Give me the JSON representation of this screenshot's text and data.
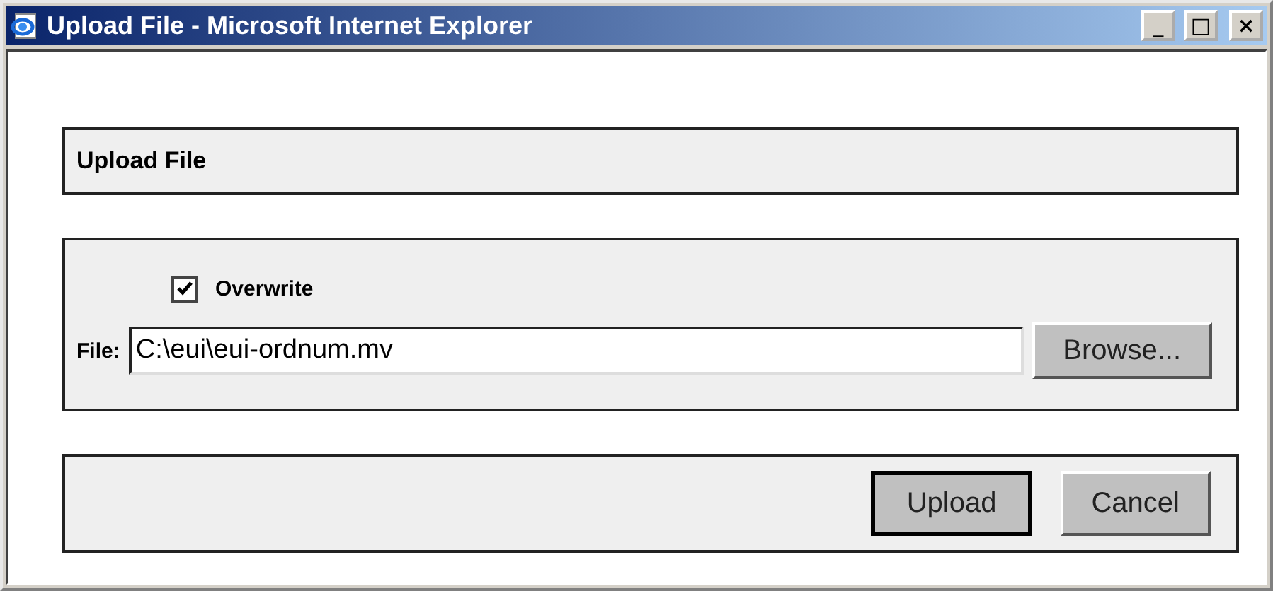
{
  "window": {
    "title": "Upload File - Microsoft Internet Explorer",
    "controls": [
      "_",
      "□",
      "×"
    ]
  },
  "header": {
    "title": "Upload File"
  },
  "options": {
    "overwrite": {
      "label": "Overwrite",
      "checked": true
    },
    "file": {
      "label": "File:",
      "value": "C:\\eui\\eui-ordnum.mv"
    },
    "browse_button": "Browse..."
  },
  "buttons": [
    {
      "label": "Upload",
      "default": true
    },
    {
      "label": "Cancel",
      "default": false
    }
  ]
}
